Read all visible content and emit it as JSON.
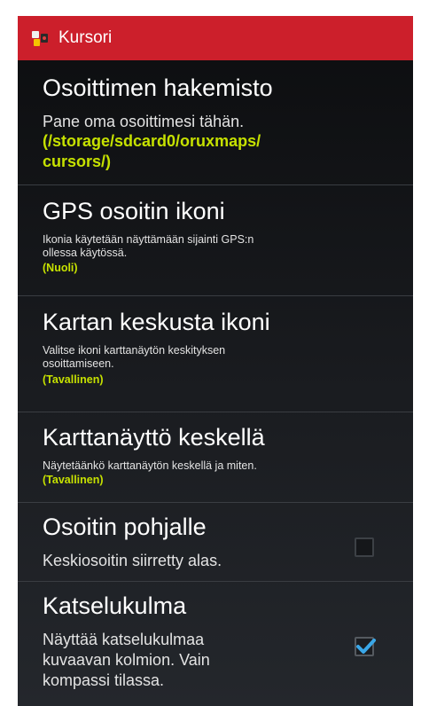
{
  "header": {
    "title": "Kursori",
    "icon": "oruxmaps-app-icon",
    "color": "#cc1f2b"
  },
  "accent_value_color": "#c6e100",
  "preferences": [
    {
      "title": "Osoittimen hakemisto",
      "summary": "Pane oma osoittimesi tähän.",
      "value": "(/storage/sdcard0/oruxmaps/\ncursors/)"
    },
    {
      "title": "GPS osoitin ikoni",
      "summary": "Ikonia käytetään näyttämään sijainti GPS:n\nollessa käytössä.",
      "value": "(Nuoli)"
    },
    {
      "title": "Kartan keskusta ikoni",
      "summary": "Valitse ikoni karttanäytön keskityksen\nosoittamiseen.",
      "value": "(Tavallinen)"
    },
    {
      "title": "Karttanäyttö keskellä",
      "summary": "Näytetäänkö karttanäytön keskellä ja miten.",
      "value": "(Tavallinen)"
    },
    {
      "title": "Osoitin pohjalle",
      "summary": "Keskiosoitin siirretty alas.",
      "checked": false
    },
    {
      "title": "Katselukulma",
      "summary": "Näyttää katselukulmaa\nkuvaavan kolmion. Vain\nkompassi tilassa.",
      "checked": true
    }
  ]
}
